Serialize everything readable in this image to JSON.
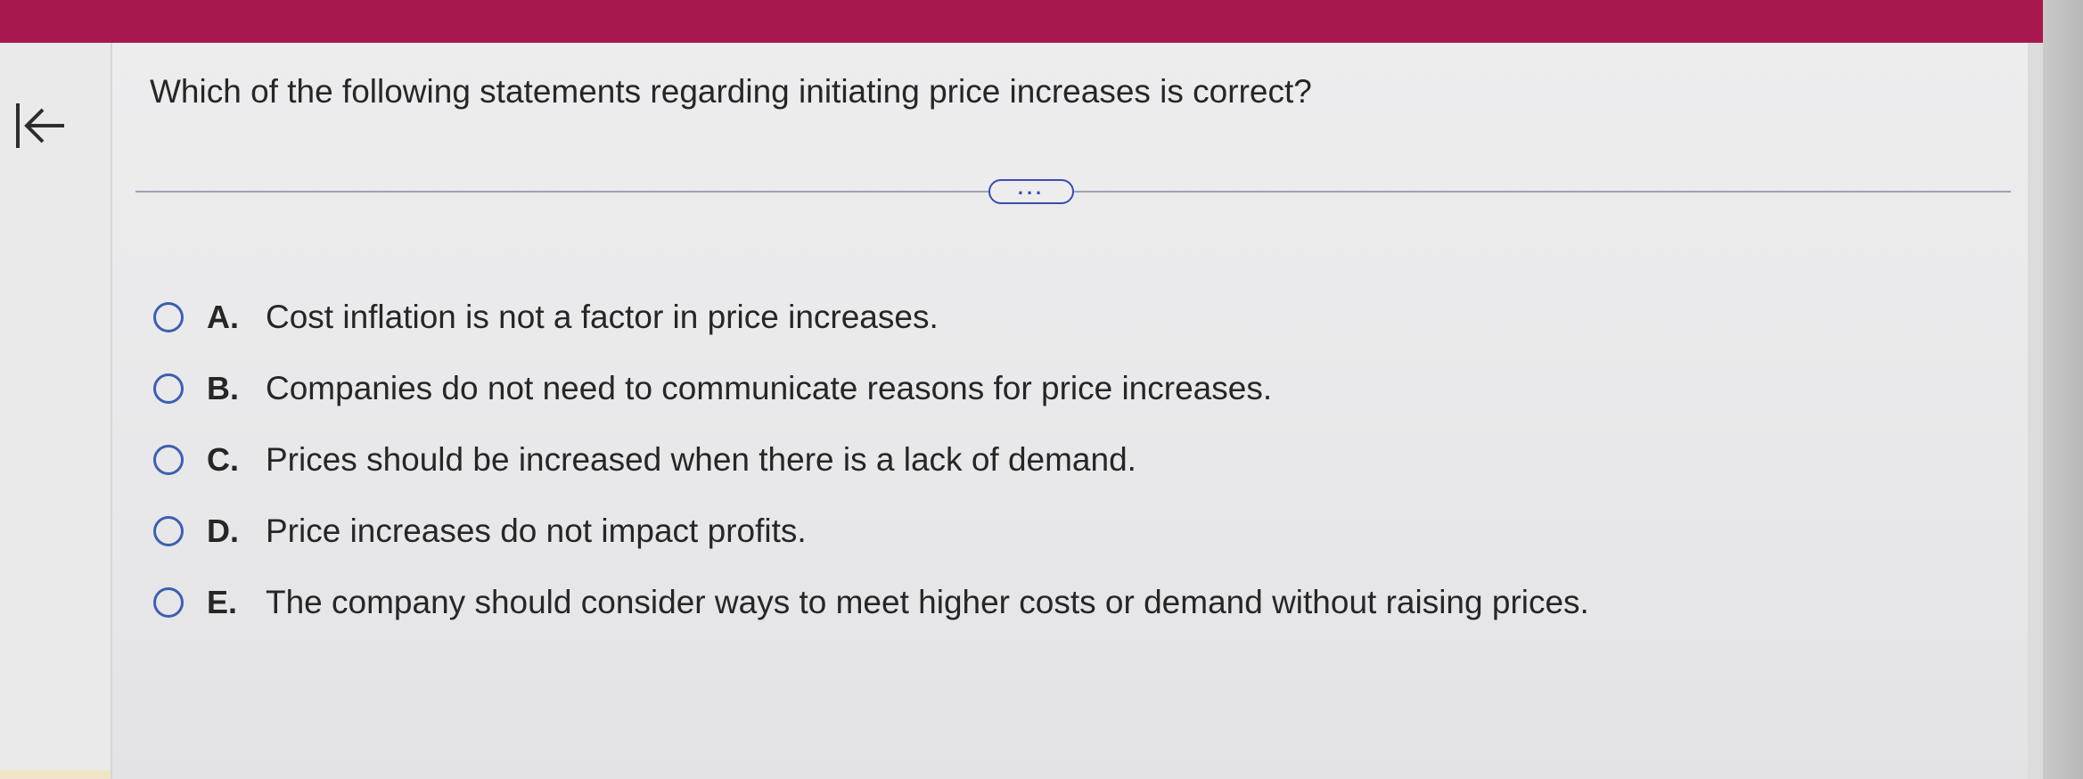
{
  "question": {
    "text": "Which of the following statements regarding initiating price increases is correct?"
  },
  "more_button": {
    "label": "..."
  },
  "options": [
    {
      "letter": "A.",
      "text": "Cost inflation is not a factor in price increases."
    },
    {
      "letter": "B.",
      "text": "Companies do not need to communicate reasons for price increases."
    },
    {
      "letter": "C.",
      "text": "Prices should be increased when there is a lack of demand."
    },
    {
      "letter": "D.",
      "text": "Price increases do not impact profits."
    },
    {
      "letter": "E.",
      "text": "The company should consider ways to meet higher costs or demand without raising prices."
    }
  ],
  "colors": {
    "top_bar": "#a8174d",
    "accent": "#3a4cae",
    "radio": "#3d5fb0",
    "text": "#262626"
  },
  "icons": {
    "back": "arrow-left-to-bar-icon"
  }
}
